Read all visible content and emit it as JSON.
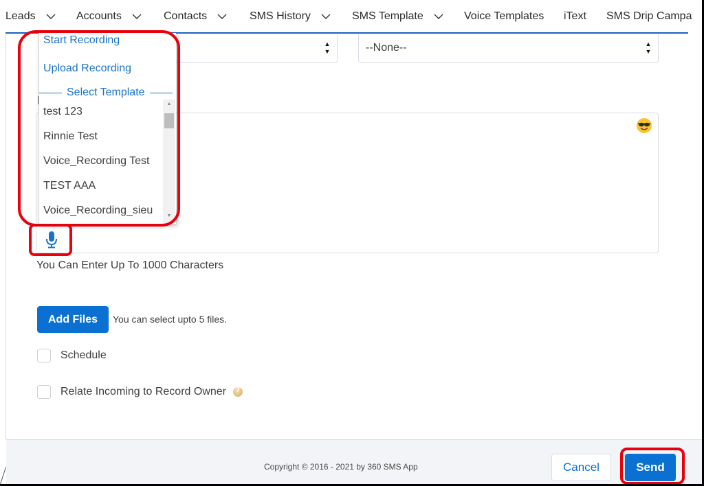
{
  "nav": {
    "items": [
      {
        "label": "Leads",
        "has_dropdown": true
      },
      {
        "label": "Accounts",
        "has_dropdown": true
      },
      {
        "label": "Contacts",
        "has_dropdown": true
      },
      {
        "label": "SMS History",
        "has_dropdown": true
      },
      {
        "label": "SMS Template",
        "has_dropdown": true
      },
      {
        "label": "Voice Templates",
        "has_dropdown": false
      },
      {
        "label": "iText",
        "has_dropdown": false
      },
      {
        "label": "SMS Drip Campa",
        "has_dropdown": false
      }
    ]
  },
  "form": {
    "left_select": {
      "value": ""
    },
    "right_select": {
      "value": "--None--"
    },
    "emoji_icon": "smiling-face-with-sunglasses",
    "mic_icon": "microphone",
    "char_limit_hint": "You Can Enter Up To 1000 Characters",
    "add_files_label": "Add Files",
    "files_note": "You can select upto 5 files.",
    "schedule_label": "Schedule",
    "schedule_checked": false,
    "relate_label": "Relate Incoming to Record Owner",
    "relate_checked": false
  },
  "dropdown": {
    "actions": [
      "Start Recording",
      "Upload Recording"
    ],
    "separator_label": "Select Template",
    "options": [
      "test 123",
      "Rinnie Test",
      "Voice_Recording Test",
      "TEST AAA",
      "Voice_Recording_sieu"
    ]
  },
  "footer": {
    "copyright": "Copyright © 2016 - 2021 by 360 SMS App",
    "cancel_label": "Cancel",
    "send_label": "Send"
  },
  "colors": {
    "brand_blue": "#0a70d2",
    "nav_underline": "#1b5fbf",
    "link_blue": "#1874c9",
    "annotation_red": "#e8000d"
  }
}
